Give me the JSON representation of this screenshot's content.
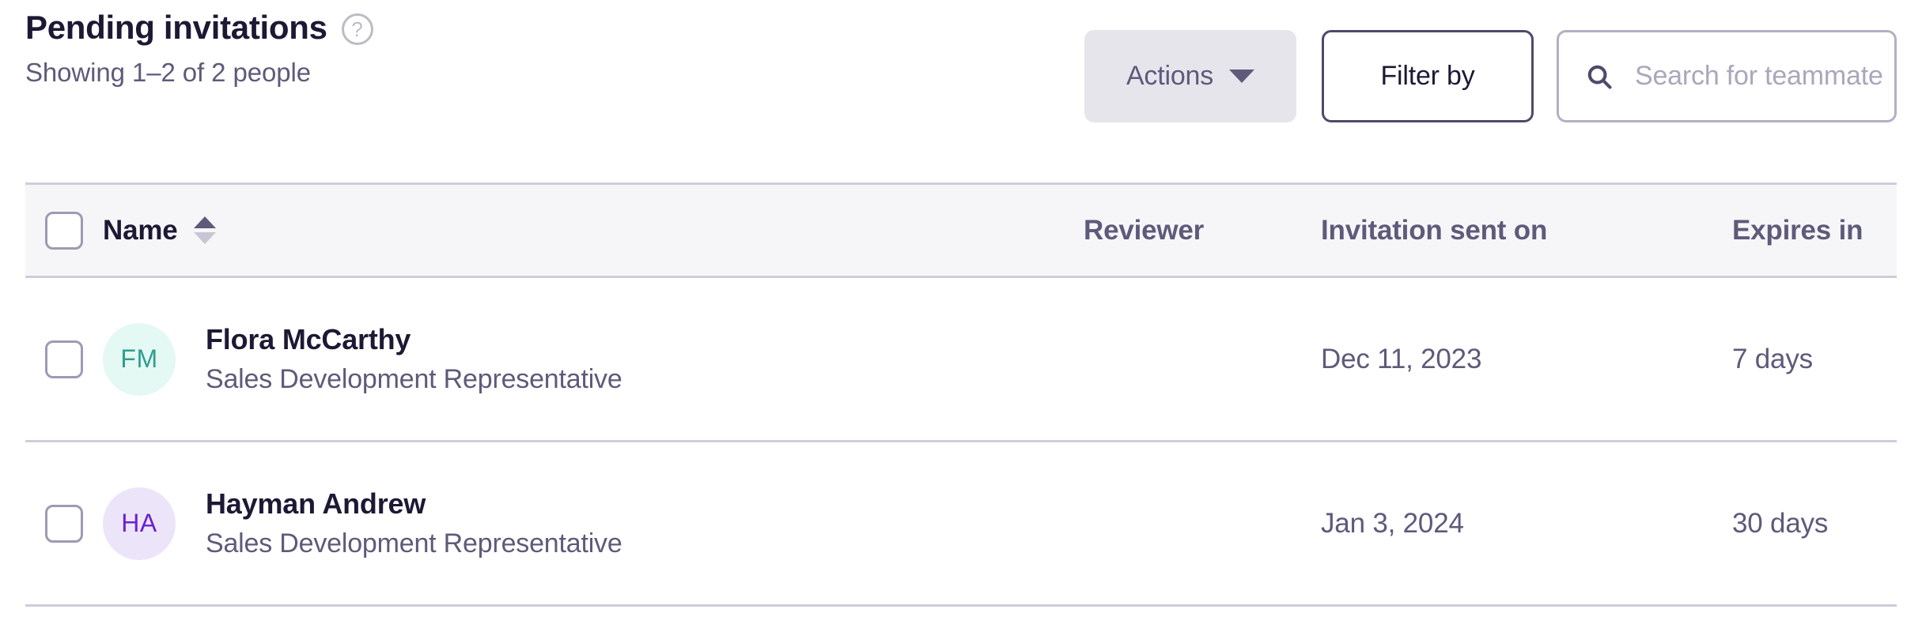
{
  "header": {
    "title": "Pending invitations",
    "help_icon": "help-circle-icon",
    "subtitle": "Showing 1–2 of 2 people"
  },
  "toolbar": {
    "actions_label": "Actions",
    "actions_caret": "chevron-down-icon",
    "filter_label": "Filter by",
    "search_icon": "search-icon",
    "search_value": "",
    "search_placeholder": "Search for teammate"
  },
  "table": {
    "select_all": "",
    "columns": {
      "name": "Name",
      "reviewer": "Reviewer",
      "sent_on": "Invitation sent on",
      "expires_in": "Expires in"
    },
    "sort": {
      "column": "Name",
      "direction": "asc"
    },
    "rows": [
      {
        "initials": "FM",
        "avatar_bg": "#e4f8f4",
        "avatar_fg": "#2f9e8f",
        "name": "Flora McCarthy",
        "role": "Sales Development Representative",
        "reviewer": "",
        "sent_on": "Dec 11, 2023",
        "expires_in": "7 days"
      },
      {
        "initials": "HA",
        "avatar_bg": "#ece5fa",
        "avatar_fg": "#6a22cf",
        "name": "Hayman Andrew",
        "role": "Sales Development Representative",
        "reviewer": "",
        "sent_on": "Jan 3, 2024",
        "expires_in": "30 days"
      }
    ]
  },
  "colors": {
    "text_dark": "#1d1934",
    "text_muted": "#5e5a7a",
    "rule": "#cfcddb",
    "header_bg": "#f6f6f8",
    "disabled_bg": "#e6e5ec",
    "border": "#b3b0c4"
  }
}
